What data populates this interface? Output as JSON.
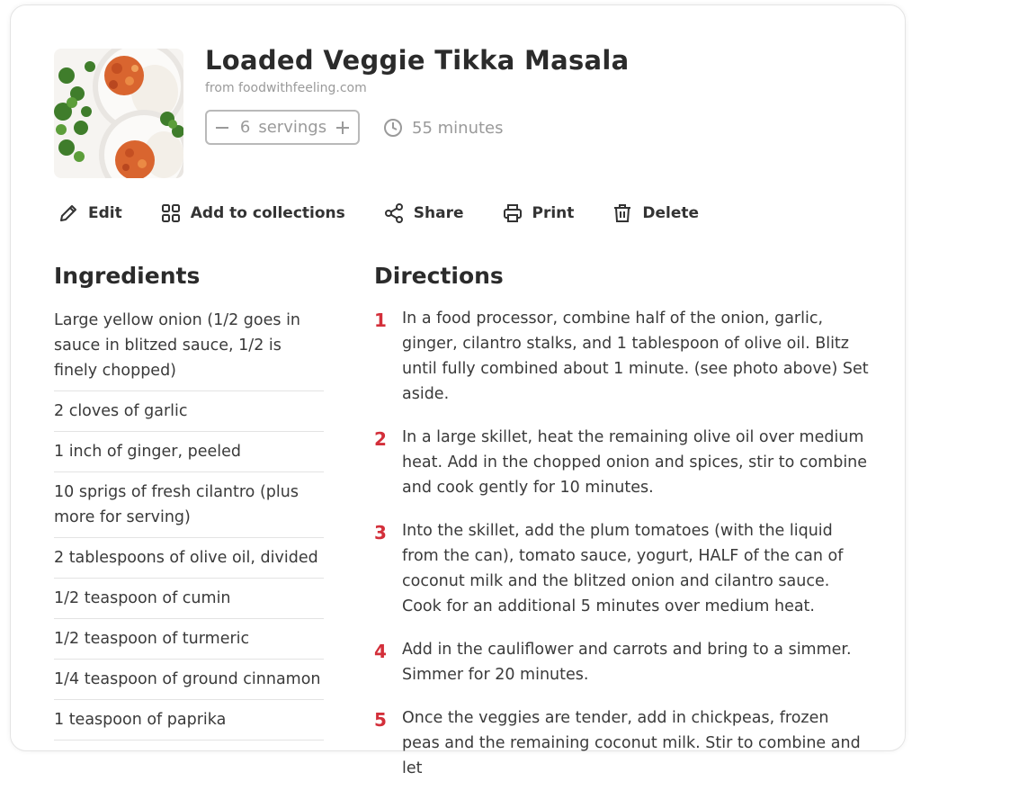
{
  "recipe": {
    "title": "Loaded Veggie Tikka Masala",
    "source": "from foodwithfeeling.com",
    "servings_count": "6",
    "servings_unit": "servings",
    "time": "55 minutes"
  },
  "actions": {
    "edit": "Edit",
    "collections": "Add to collections",
    "share": "Share",
    "print": "Print",
    "delete": "Delete"
  },
  "sections": {
    "ingredients": "Ingredients",
    "directions": "Directions"
  },
  "ingredients": [
    "Large yellow onion (1/2 goes in sauce in blitzed sauce, 1/2 is finely chopped)",
    "2 cloves of garlic",
    "1 inch of ginger, peeled",
    "10 sprigs of fresh cilantro (plus more for serving)",
    "2 tablespoons of olive oil, divided",
    "1/2 teaspoon of cumin",
    "1/2 teaspoon of turmeric",
    "1/4 teaspoon of ground cinnamon",
    "1 teaspoon of paprika"
  ],
  "directions": [
    {
      "num": "1",
      "text": "In a food processor, combine half of the onion, garlic, ginger, cilantro stalks, and 1 tablespoon of olive oil. Blitz until fully combined about 1 minute. (see photo above) Set aside."
    },
    {
      "num": "2",
      "text": "In a large skillet, heat the remaining olive oil over medium heat. Add in the chopped onion and spices, stir to combine and cook gently for 10 minutes."
    },
    {
      "num": "3",
      "text": "Into the skillet, add the plum tomatoes (with the liquid from the can), tomato sauce, yogurt, HALF of the can of coconut milk and the blitzed onion and cilantro sauce. Cook for an additional 5 minutes over medium heat."
    },
    {
      "num": "4",
      "text": "Add in the cauliflower and carrots and bring to a simmer. Simmer for 20 minutes."
    },
    {
      "num": "5",
      "text": "Once the veggies are tender, add in chickpeas, frozen peas and the remaining coconut milk. Stir to combine and let"
    }
  ],
  "colors": {
    "step_number": "#d32f3a",
    "muted_text": "#9a9a9a"
  }
}
